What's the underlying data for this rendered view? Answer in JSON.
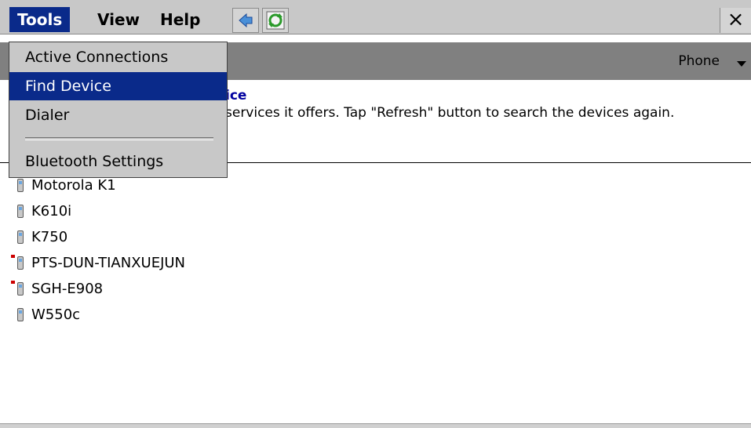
{
  "menubar": {
    "tools": "Tools",
    "view": "View",
    "help": "Help",
    "close": "×"
  },
  "toolbar": {
    "back_icon": "back-arrow-icon",
    "refresh_icon": "refresh-icon"
  },
  "subbar": {
    "selector_label": "Phone"
  },
  "content": {
    "heading": "ice",
    "instructions": "services it offers. Tap \"Refresh\" button to search the devices again."
  },
  "devices": [
    {
      "name": "Motorola K1",
      "connected": false
    },
    {
      "name": "K610i",
      "connected": false
    },
    {
      "name": "K750",
      "connected": false
    },
    {
      "name": "PTS-DUN-TIANXUEJUN",
      "connected": true
    },
    {
      "name": "SGH-E908",
      "connected": true
    },
    {
      "name": "W550c",
      "connected": false
    }
  ],
  "tools_menu": {
    "items": [
      "Active Connections",
      "Find Device",
      "Dialer",
      "Bluetooth Settings"
    ],
    "selected": "Find Device"
  },
  "colors": {
    "highlight": "#0a2a8a",
    "heading": "#0000a0",
    "connected_marker": "#cc0000"
  }
}
